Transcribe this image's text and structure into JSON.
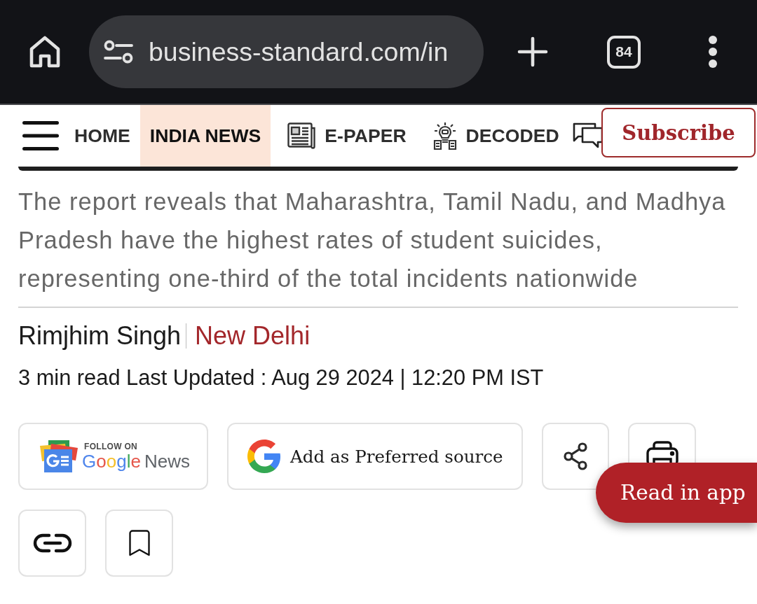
{
  "browser": {
    "url": "business-standard.com/in",
    "tab_count": "84"
  },
  "nav": {
    "items": [
      {
        "label": "HOME",
        "kind": "plain",
        "selected": false
      },
      {
        "label": "INDIA NEWS",
        "kind": "plain",
        "selected": true
      },
      {
        "label": "E-PAPER",
        "kind": "iconed",
        "selected": false
      },
      {
        "label": "DECODED",
        "kind": "iconed",
        "selected": false
      }
    ],
    "subscribe": "Subscribe"
  },
  "article": {
    "summary": "The report reveals that Maharashtra, Tamil Nadu, and Madhya Pradesh have the highest rates of student suicides, representing one-third of the total incidents nationwide",
    "author": "Rimjhim Singh",
    "location": "New Delhi",
    "meta": "3 min read Last Updated : Aug 29 2024 | 12:20 PM IST"
  },
  "actions": [
    {
      "kind": "google_news",
      "caption": "FOLLOW ON",
      "brand": "Google",
      "product": "News"
    },
    {
      "kind": "preferred_source",
      "label": "Add as Preferred source"
    },
    {
      "kind": "share"
    },
    {
      "kind": "print"
    },
    {
      "kind": "link"
    },
    {
      "kind": "bookmark"
    }
  ],
  "read_in_app": "Read in app"
}
